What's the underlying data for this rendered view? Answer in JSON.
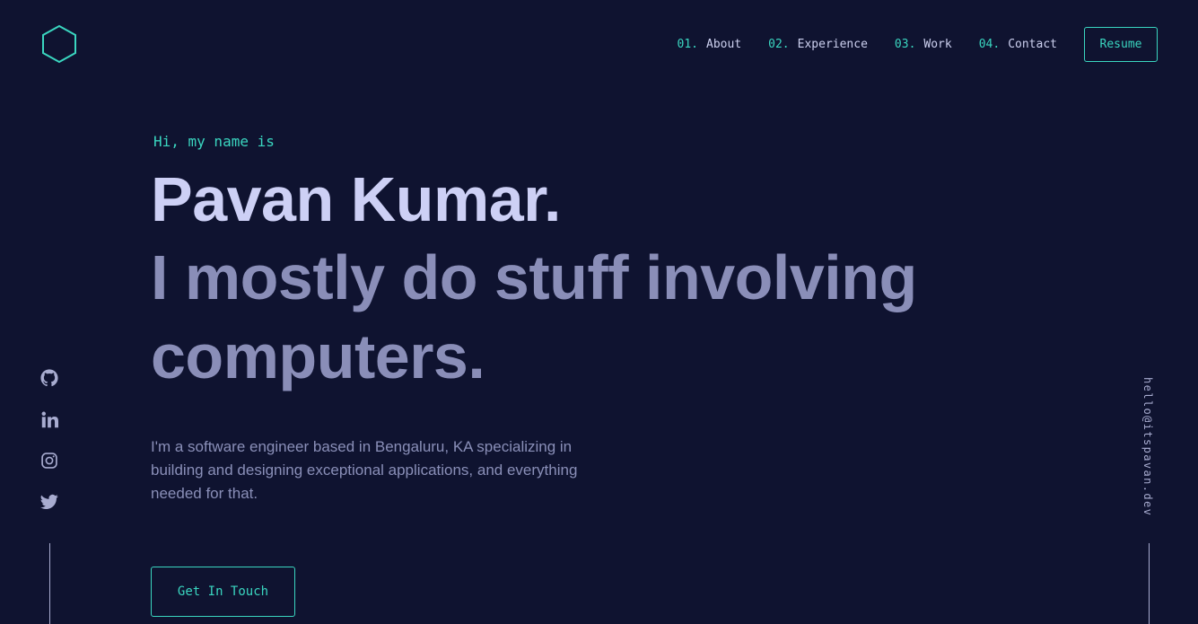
{
  "logo": {
    "icon": "hexagon-logo-icon",
    "color": "#3ad6c0"
  },
  "nav": {
    "items": [
      {
        "num": "01.",
        "label": "About"
      },
      {
        "num": "02.",
        "label": "Experience"
      },
      {
        "num": "03.",
        "label": "Work"
      },
      {
        "num": "04.",
        "label": "Contact"
      }
    ],
    "resume_label": "Resume"
  },
  "hero": {
    "greeting": "Hi, my name is",
    "name": "Pavan Kumar.",
    "tagline": "I mostly do stuff involving computers.",
    "bio": "I'm a software engineer based in Bengaluru, KA specializing in building and designing exceptional applications, and everything needed for that.",
    "cta_label": "Get In Touch"
  },
  "social": [
    {
      "icon": "github-icon"
    },
    {
      "icon": "linkedin-icon"
    },
    {
      "icon": "instagram-icon"
    },
    {
      "icon": "twitter-icon"
    }
  ],
  "email": "hello@itspavan.dev",
  "colors": {
    "background": "#0f1330",
    "accent": "#3ad6c0",
    "heading": "#cdd0f5",
    "muted": "#8a8eb8"
  }
}
